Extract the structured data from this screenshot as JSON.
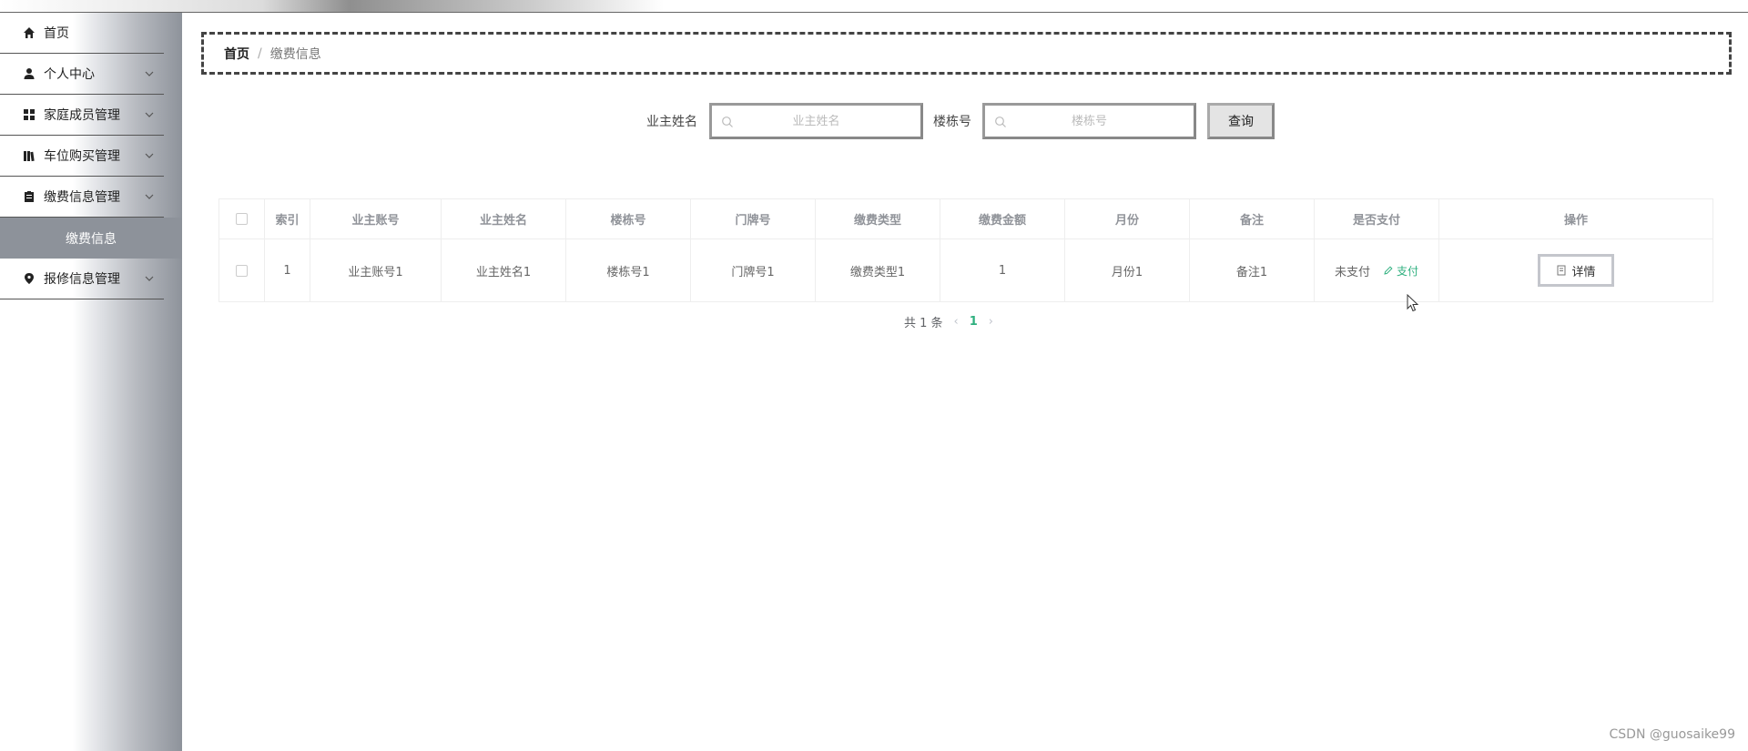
{
  "sidebar": {
    "items": [
      {
        "label": "首页",
        "icon": "home-icon",
        "has_children": false
      },
      {
        "label": "个人中心",
        "icon": "user-icon",
        "has_children": true
      },
      {
        "label": "家庭成员管理",
        "icon": "grid-icon",
        "has_children": true
      },
      {
        "label": "车位购买管理",
        "icon": "books-icon",
        "has_children": true
      },
      {
        "label": "缴费信息管理",
        "icon": "clipboard-icon",
        "has_children": true,
        "expanded": true
      },
      {
        "label": "报修信息管理",
        "icon": "location-pin-icon",
        "has_children": true
      }
    ],
    "sub_item": {
      "label": "缴费信息",
      "active": true
    }
  },
  "breadcrumb": {
    "home": "首页",
    "separator": "/",
    "current": "缴费信息"
  },
  "search": {
    "owner_name_label": "业主姓名",
    "owner_name_placeholder": "业主姓名",
    "building_label": "楼栋号",
    "building_placeholder": "楼栋号",
    "query_button": "查询"
  },
  "table": {
    "columns": [
      "索引",
      "业主账号",
      "业主姓名",
      "楼栋号",
      "门牌号",
      "缴费类型",
      "缴费金额",
      "月份",
      "备注",
      "是否支付",
      "操作"
    ],
    "rows": [
      {
        "index": "1",
        "account": "业主账号1",
        "name": "业主姓名1",
        "building": "楼栋号1",
        "door": "门牌号1",
        "fee_type": "缴费类型1",
        "amount": "1",
        "month": "月份1",
        "remark": "备注1",
        "paid_status": "未支付",
        "pay_action": "支付",
        "detail_action": "详情"
      }
    ]
  },
  "pagination": {
    "total_text": "共 1 条",
    "current_page": "1"
  },
  "watermark": "CSDN @guosaike99",
  "colors": {
    "accent": "#2fb07f",
    "submenu_bg": "#8d929a"
  }
}
